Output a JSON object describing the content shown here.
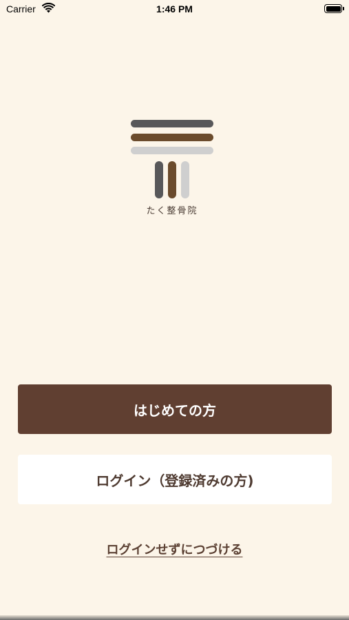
{
  "status_bar": {
    "carrier": "Carrier",
    "time": "1:46 PM",
    "battery_level": 1.0
  },
  "logo": {
    "text": "たく整骨院",
    "colors": {
      "dark_gray": "#58585a",
      "brown": "#6b4b2c",
      "light_gray": "#cfcfcf"
    }
  },
  "actions": {
    "first_time_label": "はじめての方",
    "login_label": "ログイン（登録済みの方)",
    "continue_without_login_label": "ログインせずにつづける"
  },
  "colors": {
    "background": "#fcf5e9",
    "primary_button": "#603f31",
    "secondary_button": "#ffffff"
  }
}
